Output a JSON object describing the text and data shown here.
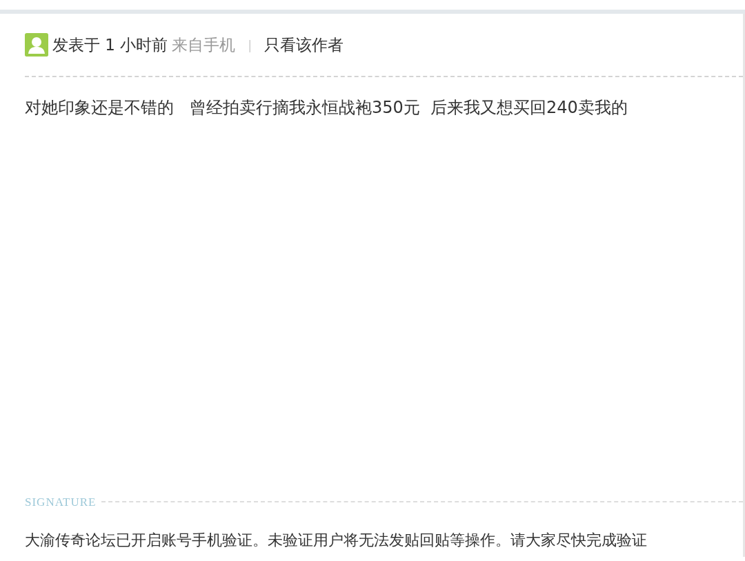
{
  "post_header": {
    "posted": "发表于 1 小时前",
    "source": "来自手机",
    "separator": "|",
    "author_only_link": "只看该作者"
  },
  "content": "对她印象还是不错的   曾经拍卖行摘我永恒战袍350元  后来我又想买回240卖我的",
  "signature": {
    "label": "SIGNATURE",
    "text": "大渝传奇论坛已开启账号手机验证。未验证用户将无法发贴回贴等操作。请大家尽快完成验证"
  }
}
